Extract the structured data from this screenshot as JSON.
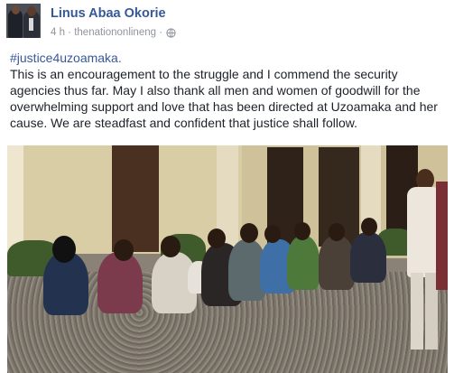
{
  "post": {
    "author": "Linus Abaa Okorie",
    "meta_text": "4 h · thenationonlineng ·",
    "hashtag": "#justice4uzoamaka.",
    "body": "This is an encouragement to the struggle and I commend the security agencies thus far. May I also thank all men and women of goodwill for the overwhelming support and love that has been directed at Uzoamaka and her cause. We are steadfast and confident that justice shall follow."
  },
  "icons": {
    "avatar": "profile-photo",
    "privacy": "globe-icon"
  },
  "colors": {
    "name": "#365899",
    "meta": "#90949c",
    "text": "#1d2129"
  }
}
